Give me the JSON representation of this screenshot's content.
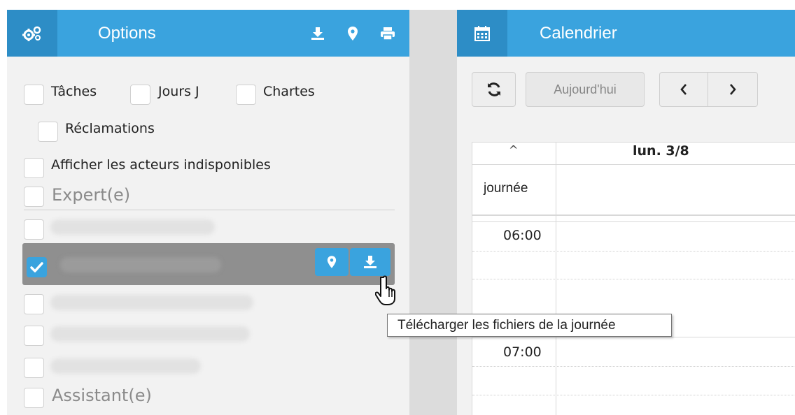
{
  "options": {
    "title": "Options",
    "icon": "gears-icon",
    "header_actions": [
      {
        "name": "download-icon"
      },
      {
        "name": "map-marker-icon"
      },
      {
        "name": "print-icon"
      }
    ],
    "filters": [
      {
        "label": "Tâches",
        "checked": false
      },
      {
        "label": "Jours J",
        "checked": false
      },
      {
        "label": "Chartes",
        "checked": false
      },
      {
        "label": "Réclamations",
        "checked": false
      }
    ],
    "show_unavailable": {
      "label": "Afficher les acteurs indisponibles",
      "checked": false
    },
    "groups": [
      {
        "label": "Expert(e)",
        "checked": false
      },
      {
        "label": "Assistant(e)",
        "checked": false
      }
    ],
    "selected_row_actions": [
      {
        "name": "map-marker-icon"
      },
      {
        "name": "download-icon"
      }
    ],
    "tooltip": "Télécharger les fichiers de la journée"
  },
  "calendar": {
    "title": "Calendrier",
    "icon": "calendar-icon",
    "toolbar": {
      "refresh": "refresh-icon",
      "today_label": "Aujourd'hui",
      "prev": "chevron-left-icon",
      "next": "chevron-right-icon"
    },
    "collapse_symbol": "^",
    "day_header": "lun. 3/8",
    "allday_label": "journée",
    "times": [
      "06:00",
      "07:00"
    ]
  },
  "colors": {
    "accent": "#3aa3de",
    "accent_dark": "#2d8dc6",
    "selected_row": "#8f8f8f"
  }
}
